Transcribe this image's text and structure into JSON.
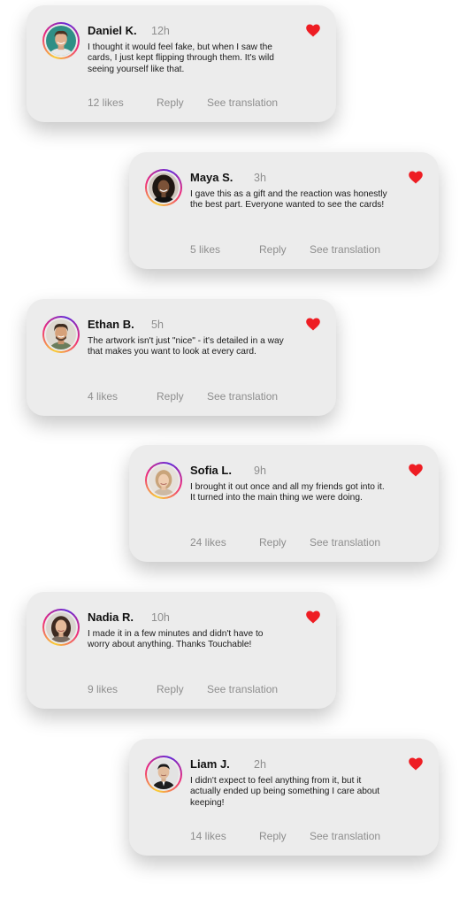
{
  "comments": [
    {
      "name": "Daniel K.",
      "time": "12h",
      "text": "I thought it would feel fake, but when I saw the cards, I just kept flipping through them. It's wild seeing yourself like that.",
      "likes": "12 likes",
      "reply": "Reply",
      "translation": "See translation",
      "liked": true
    },
    {
      "name": "Maya S.",
      "time": "3h",
      "text": "I gave this as a gift and the reaction was honestly the best part. Everyone wanted to see the cards!",
      "likes": "5 likes",
      "reply": "Reply",
      "translation": "See translation",
      "liked": true
    },
    {
      "name": "Ethan B.",
      "time": "5h",
      "text": "The artwork isn't just \"nice\" - it's detailed in a way that makes you want to look at every card.",
      "likes": "4 likes",
      "reply": "Reply",
      "translation": "See translation",
      "liked": true
    },
    {
      "name": "Sofia L.",
      "time": "9h",
      "text": "I brought it out once and all my friends got into it. It turned into the main thing we were doing.",
      "likes": "24 likes",
      "reply": "Reply",
      "translation": "See translation",
      "liked": true
    },
    {
      "name": "Nadia R.",
      "time": "10h",
      "text": "I made it in a few minutes and didn't have to worry about anything. Thanks Touchable!",
      "likes": "9 likes",
      "reply": "Reply",
      "translation": "See translation",
      "liked": true
    },
    {
      "name": "Liam J.",
      "time": "2h",
      "text": "I didn't expect to feel anything from it, but it actually ended up being something I care about keeping!",
      "likes": "14 likes",
      "reply": "Reply",
      "translation": "See translation",
      "liked": true
    }
  ],
  "colors": {
    "heart": "#ee1d23",
    "card": "#ececec",
    "muted": "#8e8e8e"
  }
}
